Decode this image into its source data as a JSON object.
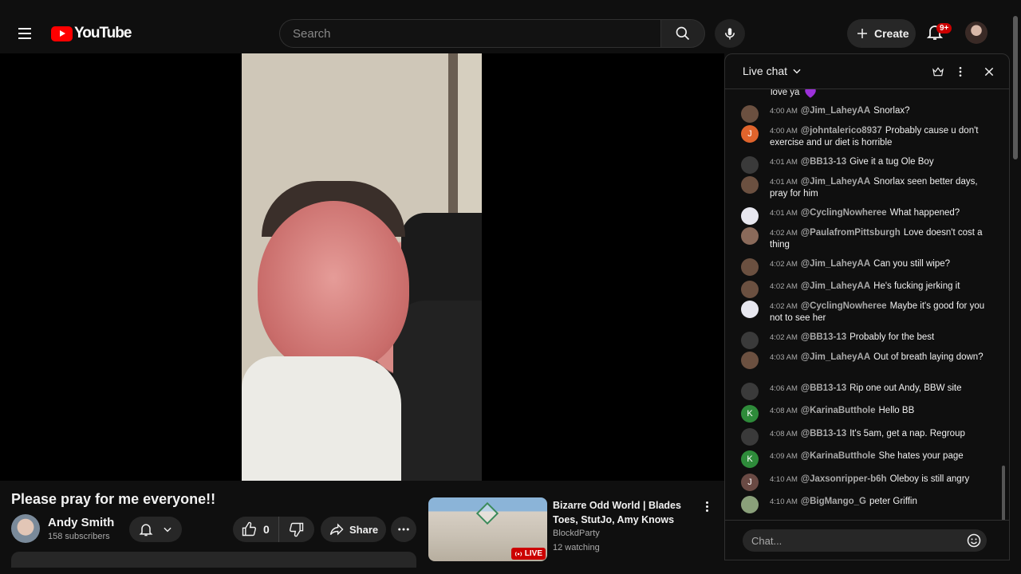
{
  "header": {
    "logo_text": "YouTube",
    "search_placeholder": "Search",
    "create_label": "Create",
    "notification_count": "9+"
  },
  "video": {
    "title": "Please pray for me everyone!!",
    "channel_name": "Andy Smith",
    "subscribers": "158 subscribers",
    "like_count": "0",
    "share_label": "Share"
  },
  "recommended": {
    "title": "Bizarre Odd World | Blades Toes, StutJo, Amy Knows",
    "channel": "BlockdParty",
    "watching": "12 watching",
    "live_label": "LIVE"
  },
  "chat": {
    "title": "Live chat",
    "partial_text": "love ya",
    "input_placeholder": "Chat...",
    "messages": [
      {
        "time": "4:00 AM",
        "author": "@Jim_LaheyAA",
        "text": "Snorlax?"
      },
      {
        "time": "4:00 AM",
        "author": "@johntalerico8937",
        "text": "Probably cause u don't exercise and ur diet is horrible"
      },
      {
        "time": "4:01 AM",
        "author": "@BB13-13",
        "text": "Give it a tug Ole Boy"
      },
      {
        "time": "4:01 AM",
        "author": "@Jim_LaheyAA",
        "text": "Snorlax seen better days, pray for him"
      },
      {
        "time": "4:01 AM",
        "author": "@CyclingNowheree",
        "text": "What happened?"
      },
      {
        "time": "4:02 AM",
        "author": "@PaulafromPittsburgh",
        "text": "Love doesn't cost a thing"
      },
      {
        "time": "4:02 AM",
        "author": "@Jim_LaheyAA",
        "text": "Can you still wipe?"
      },
      {
        "time": "4:02 AM",
        "author": "@Jim_LaheyAA",
        "text": "He's fucking jerking it"
      },
      {
        "time": "4:02 AM",
        "author": "@CyclingNowheree",
        "text": "Maybe it's good for you not to see her"
      },
      {
        "time": "4:02 AM",
        "author": "@BB13-13",
        "text": "Probably for the best"
      },
      {
        "time": "4:03 AM",
        "author": "@Jim_LaheyAA",
        "text": "Out of breath laying down?"
      },
      {
        "time": "4:06 AM",
        "author": "@BB13-13",
        "text": "Rip one out Andy, BBW site"
      },
      {
        "time": "4:08 AM",
        "author": "@KarinaButthole",
        "text": "Hello BB"
      },
      {
        "time": "4:08 AM",
        "author": "@BB13-13",
        "text": "It's 5am, get a nap. Regroup"
      },
      {
        "time": "4:09 AM",
        "author": "@KarinaButthole",
        "text": "She hates your page"
      },
      {
        "time": "4:10 AM",
        "author": "@Jaxsonripper-b6h",
        "text": "Oleboy is still angry"
      },
      {
        "time": "4:10 AM",
        "author": "@BigMango_G",
        "text": "peter Griffin"
      }
    ],
    "avatars": [
      {
        "letter": "",
        "color": "#6b5040"
      },
      {
        "letter": "J",
        "color": "#e0642c"
      },
      {
        "letter": "",
        "color": "#3a3a3a"
      },
      {
        "letter": "",
        "color": "#6b5040"
      },
      {
        "letter": "",
        "color": "#e8e8f0"
      },
      {
        "letter": "",
        "color": "#8a6a5a"
      },
      {
        "letter": "",
        "color": "#6b5040"
      },
      {
        "letter": "",
        "color": "#6b5040"
      },
      {
        "letter": "",
        "color": "#e8e8f0"
      },
      {
        "letter": "",
        "color": "#3a3a3a"
      },
      {
        "letter": "",
        "color": "#6b5040"
      },
      {
        "letter": "",
        "color": "#3a3a3a"
      },
      {
        "letter": "K",
        "color": "#2e8b3a"
      },
      {
        "letter": "",
        "color": "#3a3a3a"
      },
      {
        "letter": "K",
        "color": "#2e8b3a"
      },
      {
        "letter": "J",
        "color": "#6a4a44"
      },
      {
        "letter": "",
        "color": "#8aa07a"
      }
    ]
  }
}
